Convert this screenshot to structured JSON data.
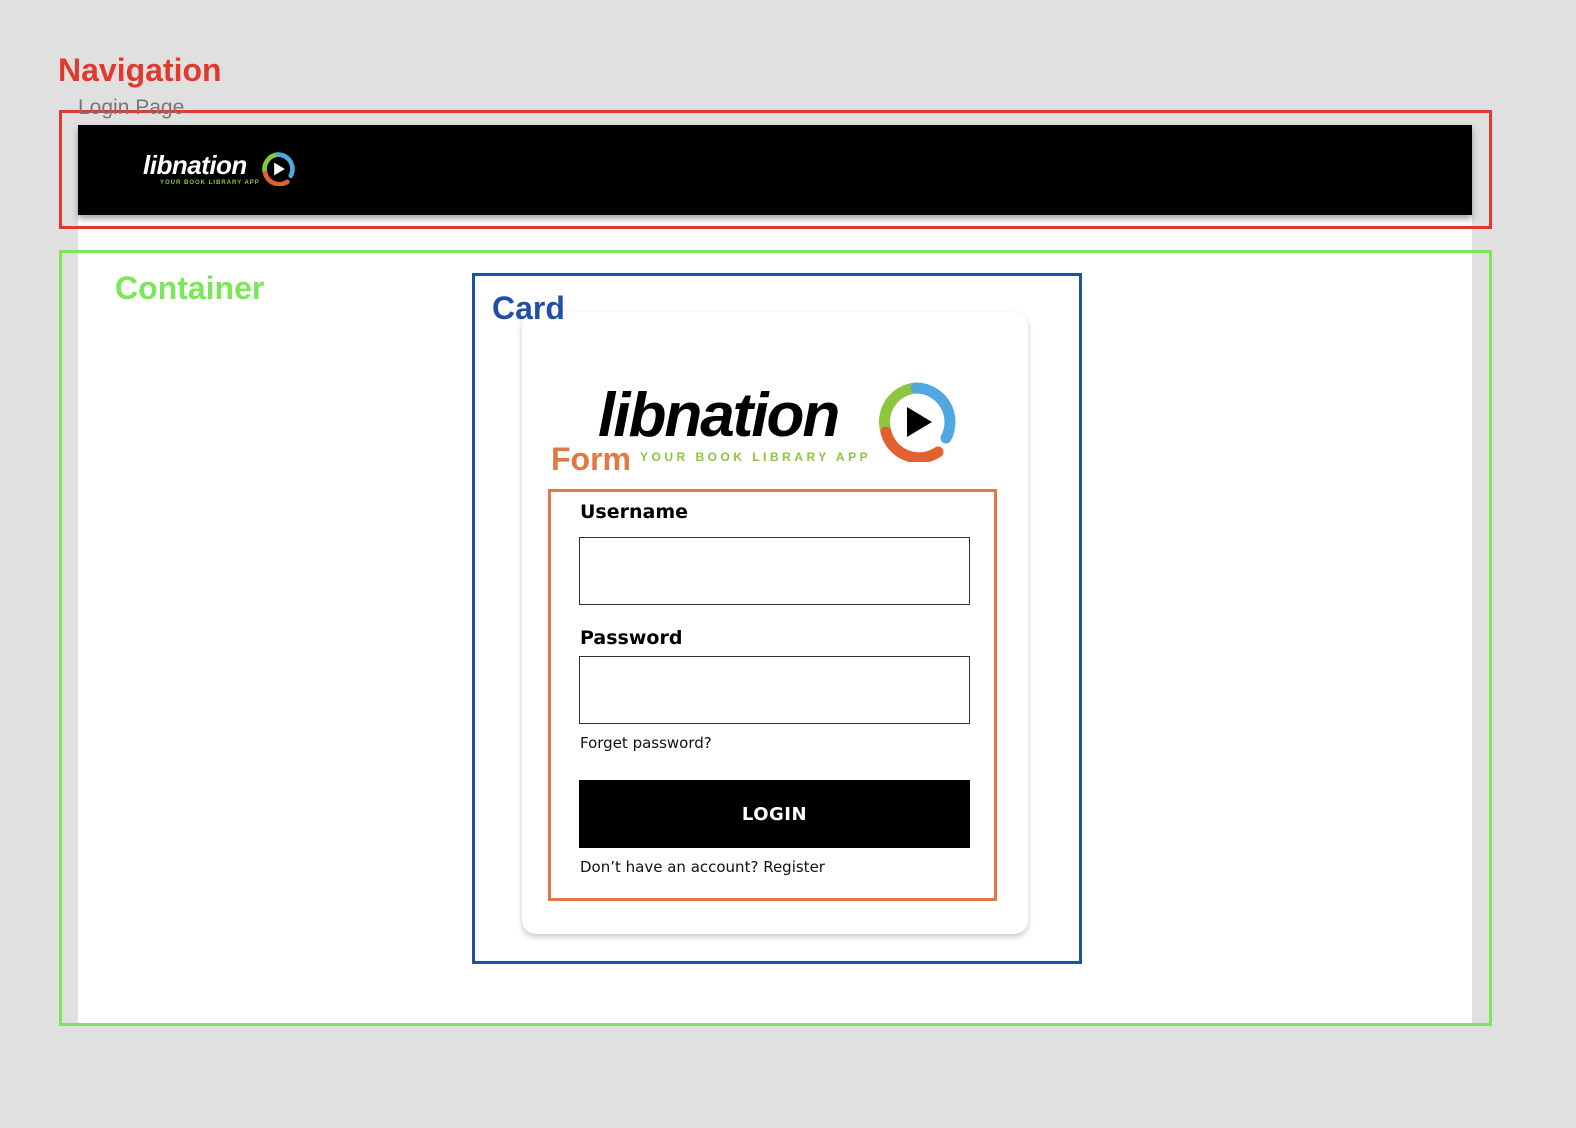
{
  "annotations": {
    "navigation": "Navigation",
    "container": "Container",
    "card": "Card",
    "form": "Form"
  },
  "frame_title": "Login Page",
  "brand": {
    "name": "libnation",
    "tagline_small": "YOUR BOOK LIBRARY APP",
    "tagline": "YOUR BOOK LIBRARY APP",
    "colors": {
      "green": "#8cc63f",
      "orange": "#e2612f",
      "blue": "#4fa8df"
    }
  },
  "form": {
    "username_label": "Username",
    "username_value": "",
    "password_label": "Password",
    "password_value": "",
    "forgot_link": "Forget password?",
    "login_button": "LOGIN",
    "register_prompt": "Don’t have an account?",
    "register_link": "Register"
  },
  "colors": {
    "annotation_navigation": "#e0392d",
    "annotation_container": "#7ae65a",
    "annotation_card": "#1f4fa8",
    "annotation_form": "#e07a44",
    "navbar_bg": "#000000",
    "button_bg": "#000000"
  }
}
